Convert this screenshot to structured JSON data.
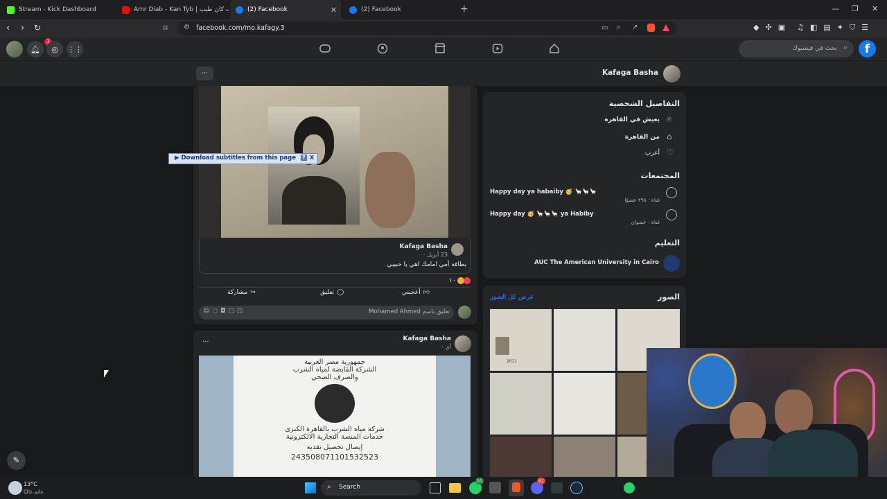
{
  "browser": {
    "tabs": [
      {
        "title": "Stream - Kick Dashboard",
        "color": "#53fc18"
      },
      {
        "title": "Amr Diab - Kan Tyb | عمرو دياب كان طيب",
        "color": "#ff0000"
      },
      {
        "title": "(2) Facebook",
        "color": "#1877f2"
      },
      {
        "title": "(2) Facebook",
        "color": "#1877f2"
      }
    ],
    "new_tab": "+",
    "url": "facebook.com/mo.kafagy.3"
  },
  "fb": {
    "search_placeholder": "بحث في فيسبوك",
    "notification_count": "2",
    "profile_name": "Kafaga Basha",
    "intro": {
      "heading": "التفاصيل الشخصية",
      "lives": "يعيش في القاهرة",
      "from": "من القاهرة",
      "relationship": "أعزب"
    },
    "communities": {
      "heading": "المجتمعات",
      "items": [
        {
          "name": "Happy day ya habaiby 🥳 🦙🦙🦙",
          "meta": "قناة · ٢٩٨ عضوًا"
        },
        {
          "name": "Happy day 🥳 🦙🦙🦙 ya Habiby",
          "meta": "قناة · عضوان"
        }
      ]
    },
    "education": {
      "heading": "التعليم",
      "school": "AUC The American University in Cairo"
    },
    "photos": {
      "heading": "الصور",
      "see_all": "عرض كل الصور",
      "first_caption": "2011"
    },
    "post1": {
      "shared_author": "Kafaga Basha",
      "shared_date": "23 أبريل ·",
      "shared_text": "بطاقة أمي امامك اهي يا حبيبي",
      "reactions": "١٠",
      "like": "أعجبني",
      "comment": "تعليق",
      "share": "مشاركة",
      "comment_placeholder": "تعليق باسم Mohamed Ahmed",
      "more": "···"
    },
    "post2": {
      "author": "Kafaga Basha",
      "date": "أي ·",
      "more": "···",
      "receipt": {
        "line1": "جمهورية مصر العربية",
        "line2": "الشركة القابضة لمياه الشرب",
        "line3": "والصرف الصحي",
        "line4": "شركة مياه الشرب بالقاهرة الكبرى",
        "line5": "خدمات المنصة التجارية الالكترونية",
        "line6": "إيصال تحصيل نقدية",
        "number": "243508071101532523"
      }
    },
    "subtitle_bar": {
      "label": "▶ Download subtitles from this page",
      "help": "?",
      "close": "X"
    }
  },
  "taskbar": {
    "weather_temp": "13°C",
    "weather_desc": "غائم غالبًا",
    "search": "Search",
    "badge1": "20",
    "badge2": "91"
  }
}
